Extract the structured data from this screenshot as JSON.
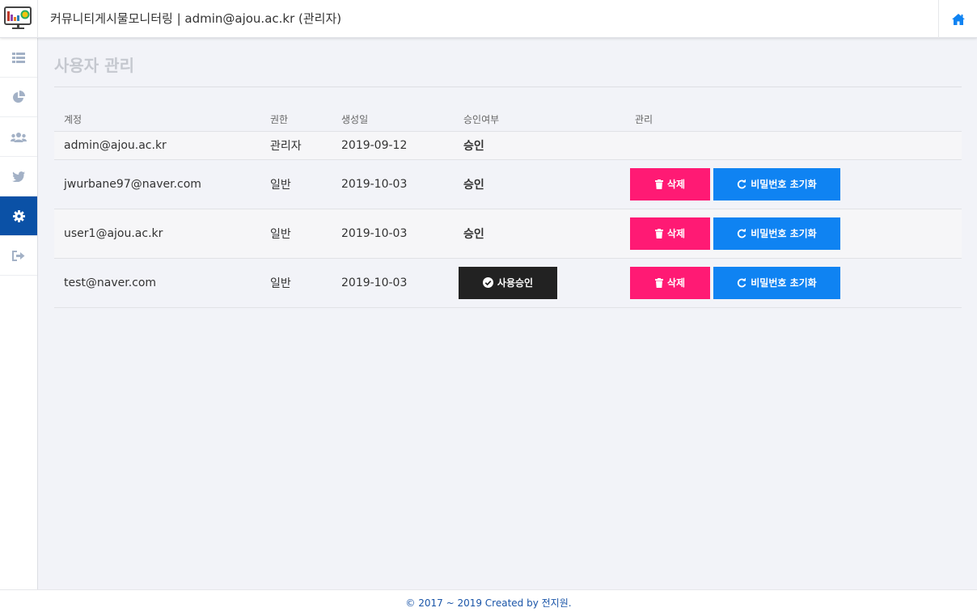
{
  "header": {
    "title": "커뮤니티게시물모니터링 | admin@ajou.ac.kr (관리자)"
  },
  "sidebar": {
    "items": [
      {
        "icon": "list-icon"
      },
      {
        "icon": "pie-chart-icon"
      },
      {
        "icon": "users-icon"
      },
      {
        "icon": "twitter-icon"
      },
      {
        "icon": "gear-icon",
        "active": true
      },
      {
        "icon": "sign-out-icon"
      }
    ]
  },
  "page": {
    "title": "사용자 관리"
  },
  "table": {
    "headers": [
      "계정",
      "권한",
      "생성일",
      "승인여부",
      "관리"
    ],
    "rows": [
      {
        "account": "admin@ajou.ac.kr",
        "role": "관리자",
        "created": "2019-09-12",
        "status": "승인"
      },
      {
        "account": "jwurbane97@naver.com",
        "role": "일반",
        "created": "2019-10-03",
        "status": "승인"
      },
      {
        "account": "user1@ajou.ac.kr",
        "role": "일반",
        "created": "2019-10-03",
        "status": "승인"
      },
      {
        "account": "test@naver.com",
        "role": "일반",
        "created": "2019-10-03",
        "status": ""
      }
    ]
  },
  "buttons": {
    "delete": "삭제",
    "reset_password": "비밀번호 초기화",
    "approve": "사용승인"
  },
  "colors": {
    "accent": "#0b51a6",
    "delete": "#ff1a74",
    "reset": "#0f83f2",
    "approve": "#222222"
  },
  "footer": {
    "text": "© 2017 ~ 2019 Created by 전지원."
  }
}
